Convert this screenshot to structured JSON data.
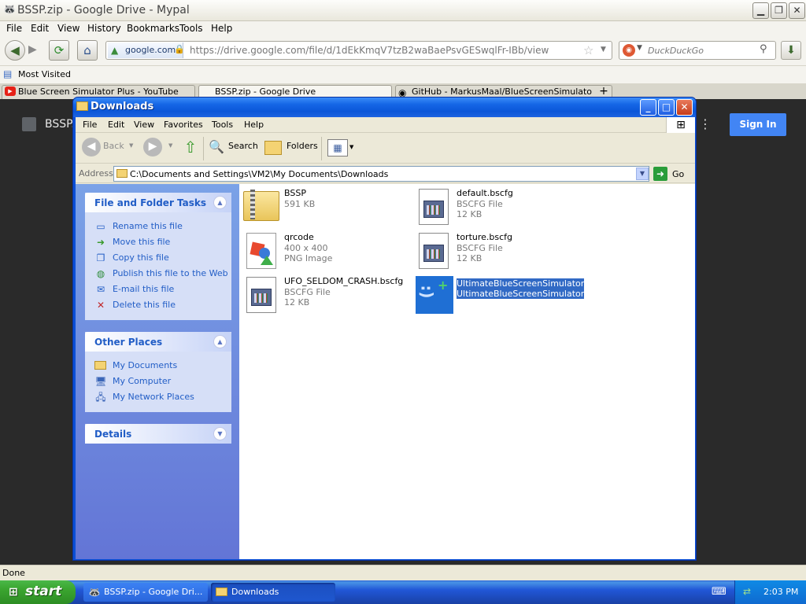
{
  "browser": {
    "title": "BSSP.zip - Google Drive - Mypal",
    "menu": [
      "File",
      "Edit",
      "View",
      "History",
      "Bookmarks",
      "Tools",
      "Help"
    ],
    "site_chip": "google.com",
    "url": "https://drive.google.com/file/d/1dEkKmqV7tzB2waBaePsvGESwqlFr-IBb/view",
    "search_placeholder": "DuckDuckGo",
    "bookmark": "Most Visited",
    "tabs": [
      "Blue Screen Simulator Plus - YouTube",
      "BSSP.zip - Google Drive",
      "GitHub - MarkusMaal/BlueScreenSimulato"
    ],
    "status": "Done"
  },
  "drive": {
    "title": "BSSP.",
    "signin_label": "Sign In"
  },
  "explorer": {
    "title": "Downloads",
    "menu": [
      "File",
      "Edit",
      "View",
      "Favorites",
      "Tools",
      "Help"
    ],
    "toolbar": {
      "back": "Back",
      "search": "Search",
      "folders": "Folders"
    },
    "address_label": "Address",
    "address": "C:\\Documents and Settings\\VM2\\My Documents\\Downloads",
    "go_label": "Go",
    "task_groups": {
      "file_folder": {
        "title": "File and Folder Tasks",
        "items": [
          "Rename this file",
          "Move this file",
          "Copy this file",
          "Publish this file to the Web",
          "E-mail this file",
          "Delete this file"
        ]
      },
      "other_places": {
        "title": "Other Places",
        "items": [
          "My Documents",
          "My Computer",
          "My Network Places"
        ]
      },
      "details": {
        "title": "Details"
      }
    },
    "files": [
      {
        "name": "BSSP",
        "meta1": "591 KB",
        "meta2": ""
      },
      {
        "name": "default.bscfg",
        "meta1": "BSCFG File",
        "meta2": "12 KB"
      },
      {
        "name": "qrcode",
        "meta1": "400 x 400",
        "meta2": "PNG Image"
      },
      {
        "name": "torture.bscfg",
        "meta1": "BSCFG File",
        "meta2": "12 KB"
      },
      {
        "name": "UFO_SELDOM_CRASH.bscfg",
        "meta1": "BSCFG File",
        "meta2": "12 KB"
      },
      {
        "name": "UltimateBlueScreenSimulator",
        "meta1": "UltimateBlueScreenSimulator",
        "meta2": ""
      }
    ]
  },
  "taskbar": {
    "start_label": "start",
    "buttons": [
      "BSSP.zip - Google Dri...",
      "Downloads"
    ],
    "clock": "2:03 PM"
  }
}
